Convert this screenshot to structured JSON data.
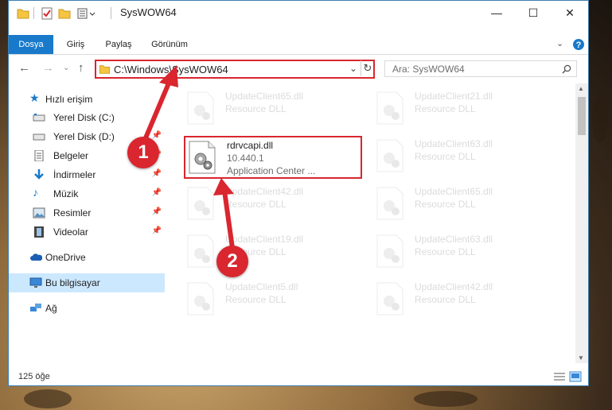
{
  "window": {
    "title": "SysWOW64"
  },
  "controls": {
    "minimize": "—",
    "maximize": "☐",
    "close": "✕"
  },
  "ribbon": {
    "tabs": [
      {
        "label": "Dosya",
        "active": true
      },
      {
        "label": "Giriş"
      },
      {
        "label": "Paylaş"
      },
      {
        "label": "Görünüm"
      }
    ]
  },
  "address": {
    "path": "C:\\Windows\\SysWOW64"
  },
  "search": {
    "placeholder": "Ara: SysWOW64"
  },
  "sidebar": {
    "quick_access": "Hızlı erişim",
    "items": [
      {
        "label": "Yerel Disk (C:)",
        "icon": "drive-icon"
      },
      {
        "label": "Yerel Disk (D:)",
        "icon": "drive-icon"
      },
      {
        "label": "Belgeler",
        "icon": "documents-icon"
      },
      {
        "label": "İndirmeler",
        "icon": "downloads-icon"
      },
      {
        "label": "Müzik",
        "icon": "music-icon"
      },
      {
        "label": "Resimler",
        "icon": "pictures-icon"
      },
      {
        "label": "Videolar",
        "icon": "videos-icon"
      }
    ],
    "onedrive": "OneDrive",
    "this_pc": "Bu bilgisayar",
    "network": "Ağ"
  },
  "files": {
    "selected": {
      "name": "rdrvcapi.dll",
      "version": "10.440.1",
      "description": "Application Center ..."
    },
    "left_col": [
      {
        "name": "UpdateClient65.dll",
        "type": "Resource DLL"
      },
      {
        "name": "UpdateClient42.dll",
        "type": "Resource DLL"
      },
      {
        "name": "UpdateClient19.dll",
        "type": "Resource DLL"
      },
      {
        "name": "UpdateClient5.dll",
        "type": "Resource DLL"
      }
    ],
    "right_col": [
      {
        "name": "UpdateClient21.dll",
        "type": "Resource DLL"
      },
      {
        "name": "UpdateClient63.dll",
        "type": "Resource DLL"
      },
      {
        "name": "UpdateClient65.dll",
        "type": "Resource DLL"
      },
      {
        "name": "UpdateClient63.dll",
        "type": "Resource DLL"
      },
      {
        "name": "UpdateClient42.dll",
        "type": "Resource DLL"
      }
    ]
  },
  "status": {
    "count": "125 öğe"
  },
  "callouts": {
    "one": "1",
    "two": "2"
  },
  "colors": {
    "accent": "#1979ca",
    "callout": "#d9262f",
    "selected_bg": "#cce8ff"
  }
}
